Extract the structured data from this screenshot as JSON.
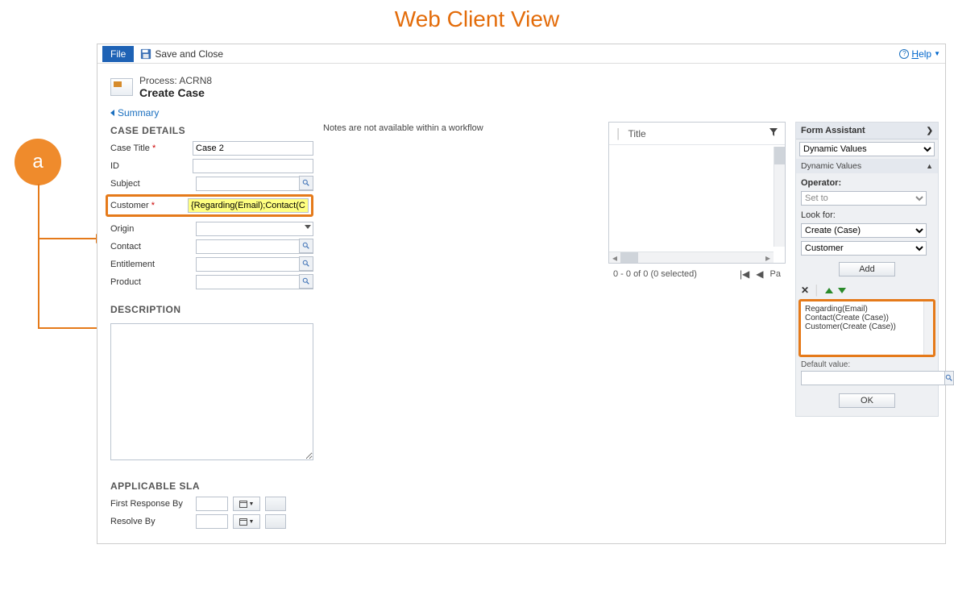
{
  "page_title": "Web Client View",
  "toolbar": {
    "file_tab": "File",
    "save_close": "Save and Close"
  },
  "help_label": "Help",
  "header": {
    "process_line": "Process: ACRN8",
    "title": "Create Case"
  },
  "summary_label": "Summary",
  "sections": {
    "case_details": "CASE DETAILS",
    "description": "DESCRIPTION",
    "applicable_sla": "APPLICABLE SLA"
  },
  "fields": {
    "case_title_label": "Case Title",
    "case_title_value": "Case 2",
    "id_label": "ID",
    "id_value": "",
    "subject_label": "Subject",
    "subject_value": "",
    "customer_label": "Customer",
    "customer_value": "{Regarding(Email);Contact(Cr",
    "origin_label": "Origin",
    "origin_value": "",
    "contact_label": "Contact",
    "contact_value": "",
    "entitlement_label": "Entitlement",
    "entitlement_value": "",
    "product_label": "Product",
    "product_value": ""
  },
  "sla": {
    "first_response_label": "First Response By",
    "resolve_label": "Resolve By"
  },
  "notes_message": "Notes are not available within a workflow",
  "list": {
    "title_col": "Title",
    "status_text": "0 - 0 of 0 (0 selected)",
    "page_label": "Pa"
  },
  "assistant": {
    "header": "Form Assistant",
    "top_select": "Dynamic Values",
    "subhead": "Dynamic Values",
    "operator_label": "Operator:",
    "operator_value": "Set to",
    "lookfor_label": "Look for:",
    "lookfor_value1": "Create (Case)",
    "lookfor_value2": "Customer",
    "add_btn": "Add",
    "selected_items": [
      "Regarding(Email)",
      "Contact(Create (Case))",
      "Customer(Create (Case))"
    ],
    "default_label": "Default value:",
    "ok_btn": "OK"
  },
  "annotation": {
    "badge": "a"
  }
}
